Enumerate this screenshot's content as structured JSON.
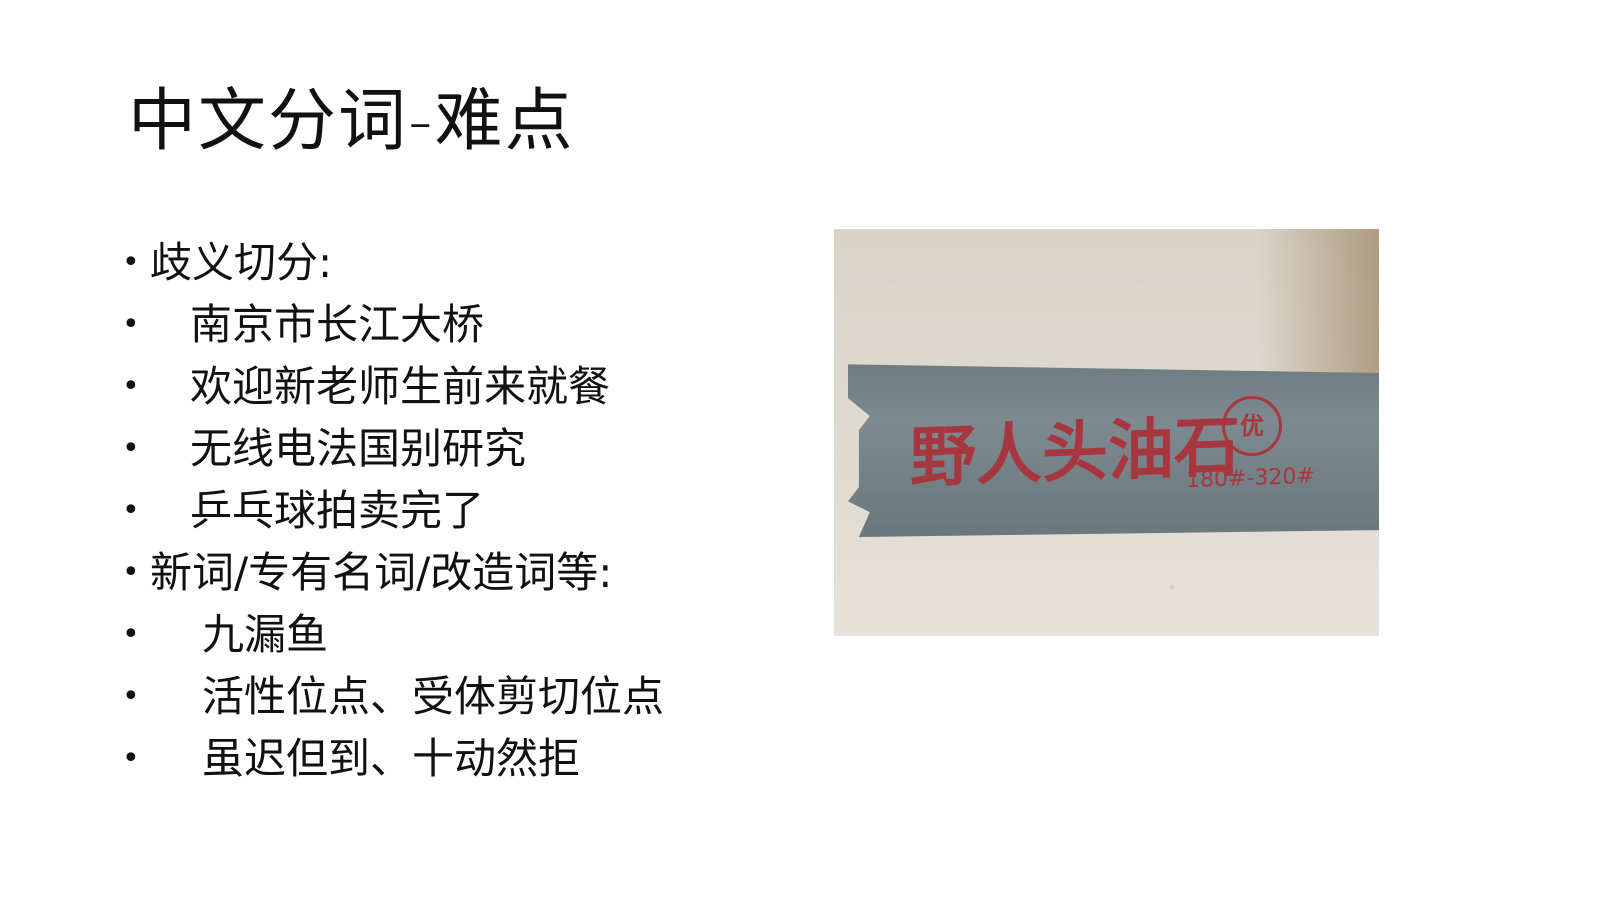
{
  "slide": {
    "title": "中文分词-难点",
    "bullets": [
      {
        "marker": "•",
        "text": "歧义切分:",
        "level": 1
      },
      {
        "marker": "•",
        "text": "南京市长江大桥",
        "level": 2
      },
      {
        "marker": "•",
        "text": "欢迎新老师生前来就餐",
        "level": 2
      },
      {
        "marker": "•",
        "text": "无线电法国别研究",
        "level": 2
      },
      {
        "marker": "•",
        "text": "乒乓球拍卖完了",
        "level": 2
      },
      {
        "marker": "•",
        "text": "新词/专有名词/改造词等:",
        "level": 1
      },
      {
        "marker": "•",
        "text": "九漏鱼",
        "level": 3
      },
      {
        "marker": "•",
        "text": "活性位点、受体剪切位点",
        "level": 3
      },
      {
        "marker": "•",
        "text": "虽迟但到、十动然拒",
        "level": 3
      }
    ]
  },
  "photo": {
    "stamp_text": "野人头油石",
    "seal_text": "优",
    "grade_text": "180#-320#"
  }
}
